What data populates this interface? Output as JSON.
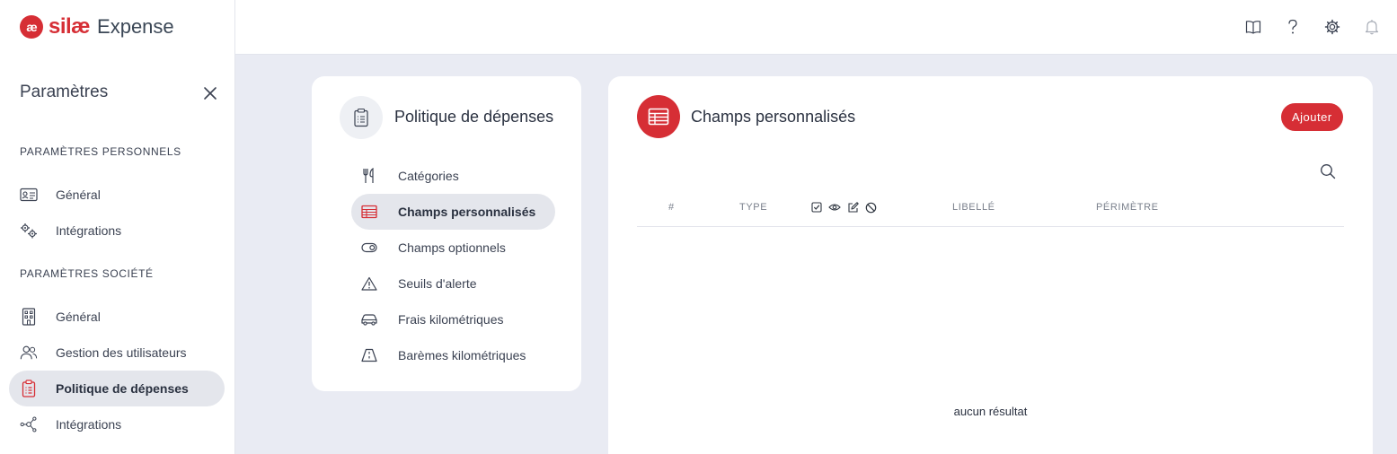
{
  "brand": {
    "name_part1": "silæ",
    "name_part2": "Expense",
    "mark": "æ",
    "accent": "#d62e35"
  },
  "sidebar": {
    "title": "Paramètres",
    "personal_section": "PARAMÈTRES PERSONNELS",
    "personal_items": [
      {
        "label": "Général",
        "icon": "id-card-icon"
      },
      {
        "label": "Intégrations",
        "icon": "gears-icon"
      }
    ],
    "company_section": "PARAMÈTRES SOCIÉTÉ",
    "company_items": [
      {
        "label": "Général",
        "icon": "building-icon"
      },
      {
        "label": "Gestion des utilisateurs",
        "icon": "users-icon"
      },
      {
        "label": "Politique de dépenses",
        "icon": "clipboard-icon",
        "active": true
      },
      {
        "label": "Intégrations",
        "icon": "network-icon"
      }
    ]
  },
  "topbar": {
    "icons": [
      "book-icon",
      "help-icon",
      "gear-icon",
      "bell-icon"
    ]
  },
  "policy": {
    "title": "Politique de dépenses",
    "items": [
      {
        "label": "Catégories",
        "icon": "utensils-icon"
      },
      {
        "label": "Champs personnalisés",
        "icon": "table-icon",
        "active": true
      },
      {
        "label": "Champs optionnels",
        "icon": "toggle-icon"
      },
      {
        "label": "Seuils d'alerte",
        "icon": "warning-icon"
      },
      {
        "label": "Frais kilométriques",
        "icon": "car-icon"
      },
      {
        "label": "Barèmes kilométriques",
        "icon": "road-icon"
      }
    ]
  },
  "main": {
    "title": "Champs personnalisés",
    "add_label": "Ajouter",
    "columns": {
      "num": "#",
      "type": "TYPE",
      "label": "LIBELLÉ",
      "scope": "PÉRIMÈTRE"
    },
    "column_icons": [
      "checkbox-icon",
      "eye-icon",
      "edit-icon",
      "ban-icon"
    ],
    "empty_text": "aucun résultat"
  }
}
